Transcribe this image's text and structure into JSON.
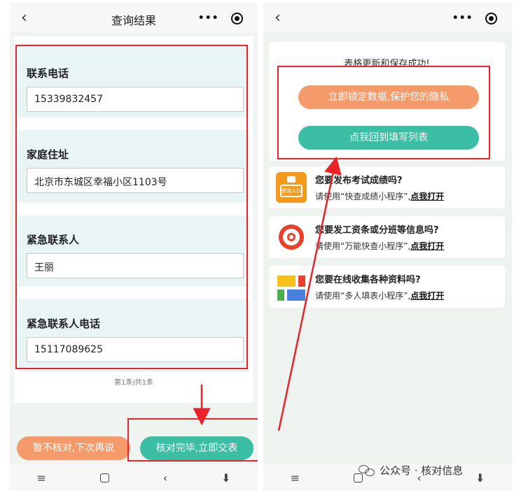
{
  "left": {
    "title": "查询结果",
    "fields": [
      {
        "label": "联系电话",
        "value": "15339832457"
      },
      {
        "label": "家庭住址",
        "value": "北京市东城区幸福小区1103号"
      },
      {
        "label": "紧急联系人",
        "value": "王丽"
      },
      {
        "label": "紧急联系人电话",
        "value": "15117089625"
      }
    ],
    "pager": "第1条/共1条",
    "skip_label": "暂不核对,下次再说",
    "submit_label": "核对完毕,立即交表"
  },
  "right": {
    "success_title": "表格更新和保存成功!",
    "lock_label": "立即锁定数据,保护您的隐私",
    "back_label": "点我回到填写列表",
    "ads": [
      {
        "question": "您要发布考试成绩吗?",
        "hint": "请使用“快查成绩小程序”,",
        "open": "点我打开",
        "logo_text": "查询入口"
      },
      {
        "question": "您要发工资条或分班等信息吗?",
        "hint": "请使用“万能快查小程序”,",
        "open": "点我打开"
      },
      {
        "question": "您要在线收集各种资料吗?",
        "hint": "请使用“多人填表小程序”,",
        "open": "点我打开"
      }
    ]
  },
  "watermark": "公众号 · 核对信息",
  "colors": {
    "orange": "#f59a6a",
    "teal": "#3cbea4",
    "highlight_red": "#e8242a"
  }
}
